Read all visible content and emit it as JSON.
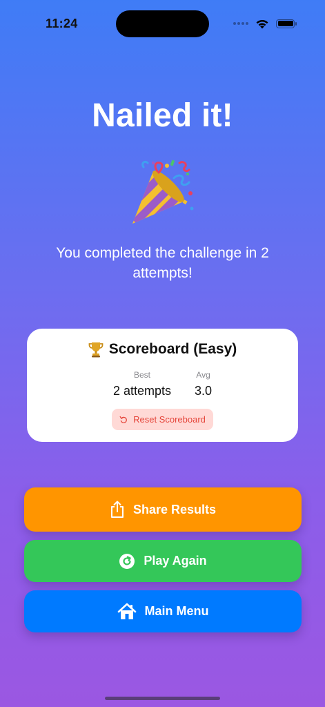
{
  "status_bar": {
    "time": "11:24"
  },
  "headline": "Nailed it!",
  "message": "You completed the challenge in 2 attempts!",
  "scoreboard": {
    "title": "Scoreboard (Easy)",
    "best_label": "Best",
    "best_value": "2 attempts",
    "avg_label": "Avg",
    "avg_value": "3.0",
    "reset_label": "Reset Scoreboard"
  },
  "actions": {
    "share_label": "Share Results",
    "play_again_label": "Play Again",
    "main_menu_label": "Main Menu"
  },
  "icons": {
    "party": "party-popper-icon",
    "trophy": "trophy-icon",
    "reset": "reset-arrow-icon",
    "share": "share-icon",
    "play_again": "replay-icon",
    "home": "home-icon"
  },
  "colors": {
    "background_top": "#3f7cf6",
    "background_bottom": "#9b57e2",
    "share": "#ff9500",
    "play_again": "#34c759",
    "main_menu": "#007aff",
    "reset_bg": "#ffd9d6",
    "reset_text": "#e5453a"
  }
}
